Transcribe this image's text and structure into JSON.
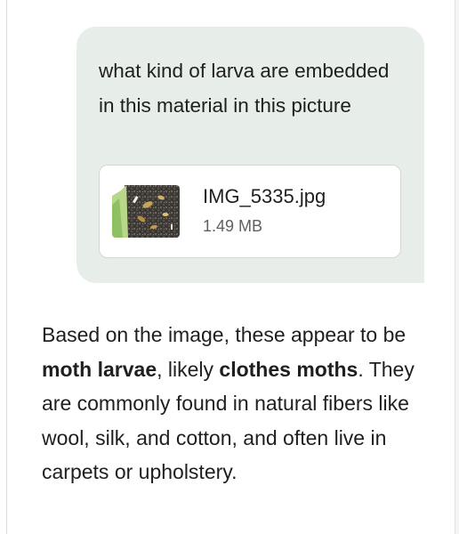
{
  "user_message": {
    "text": "what kind of larva are embedded in this material in this picture",
    "attachment": {
      "file_name": "IMG_5335.jpg",
      "file_size": "1.49 MB",
      "icon": "image-thumbnail"
    }
  },
  "assistant_message": {
    "part1": "Based on the image, these appear to be ",
    "bold1": "moth larvae",
    "part2": ", likely ",
    "bold2": "clothes moths",
    "part3": ". They are commonly found in natural fibers like wool, silk, and cotton, and often live in carpets or upholstery."
  },
  "colors": {
    "user_bubble": "#e7ede9",
    "attachment_border": "#d6d6d6",
    "secondary_text": "#5f5f5f"
  }
}
